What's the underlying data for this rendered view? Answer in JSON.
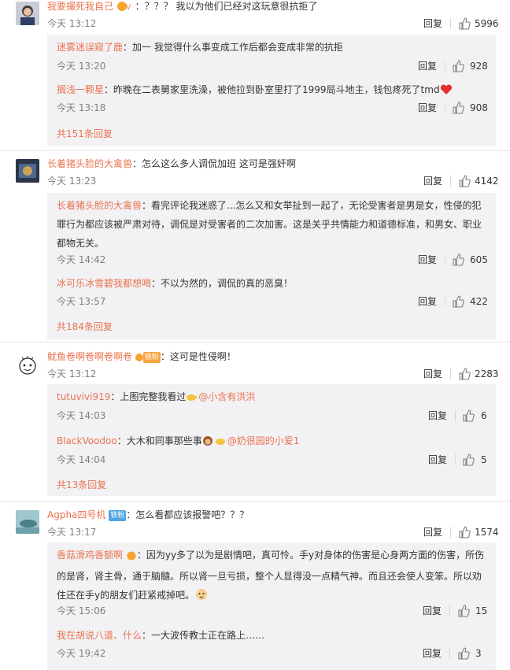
{
  "labels": {
    "reply": "回复"
  },
  "colors": {
    "link": "#eb7350",
    "reply_bg": "#f2f2f5",
    "text": "#333333",
    "meta": "#808080"
  },
  "comments": [
    {
      "user": "我要撮死我自己",
      "badge_icon": "vip-crown-icon",
      "text": "：？？？ 我以为他们已经对这玩意很抗拒了",
      "time": "今天 13:12",
      "likes": "5996",
      "replies": [
        {
          "user": "迷雾迷误窥了鹿",
          "text": "：加一    我觉得什么事变成工作后都会变成非常的抗拒",
          "time": "今天 13:20",
          "likes": "928"
        },
        {
          "user": "搁浅一颗星",
          "text": "：昨晚在二表舅家里洗澡，被他拉到卧室里打了1999局斗地主，钱包疼死了tmd",
          "emoji": "heart-emoji",
          "time": "今天 13:18",
          "likes": "908"
        }
      ],
      "more": "共151条回复"
    },
    {
      "user": "长着猪头脸的大禽兽",
      "text": "：怎么这么多人调侃加班 这可是强奸啊",
      "time": "今天 13:23",
      "likes": "4142",
      "replies": [
        {
          "user": "长着猪头脸的大禽兽",
          "text": "：看完评论我迷惑了...怎么又和女举扯到一起了，无论受害者是男是女，性侵的犯罪行为都应该被严肃对待，调侃是对受害者的二次加害。这是关乎共情能力和道德标准，和男女、职业都物无关。",
          "time": "今天 14:42",
          "likes": "605"
        },
        {
          "user": "冰可乐冰雪碧我都想喝",
          "text": "：不以为然的，调侃的真的恶臭！",
          "time": "今天 13:57",
          "likes": "422"
        }
      ],
      "more": "共184条回复"
    },
    {
      "user": "鱿鱼卷啊卷啊卷啊卷",
      "badge_text": "铁粉",
      "text": "：这可是性侵啊！",
      "time": "今天 13:12",
      "likes": "2283",
      "replies": [
        {
          "user": "tutuvivi919",
          "text": "：上图完整我看过",
          "emoji": "point-right-emoji",
          "mention": "@小含有洪洪",
          "time": "今天 14:03",
          "likes": "6"
        },
        {
          "user": "BlackVoodoo",
          "text": "：大木和同事那些事",
          "emoji": "monkey-point-emoji",
          "mention": "@奶很园的小爱1",
          "time": "今天 14:04",
          "likes": "5"
        }
      ],
      "more": "共13条回复"
    },
    {
      "user": "Agpha四号机",
      "badge_text": "铁粉",
      "text": "：怎么看都应该报警吧？？？",
      "time": "今天 13:17",
      "likes": "1574",
      "replies": [
        {
          "user": "香菇滑鸡香额啊",
          "text": "：因为yy多了以为是剧情吧，真可怜。手y对身体的伤害是心身两方面的伤害，所伤的是肾，肾主骨，通于脑髓。所以肾一旦亏损，整个人显得没一点精气神。而且还会使人变笨。所以劝住还在手y的朋友们赶紧戒掉吧。",
          "emoji": "doge-emoji",
          "time": "今天 15:06",
          "likes": "15"
        },
        {
          "user": "我在胡说八道、什么",
          "text": "：一大波传教士正在路上……",
          "time": "今天 19:42",
          "likes": "3"
        }
      ]
    }
  ]
}
